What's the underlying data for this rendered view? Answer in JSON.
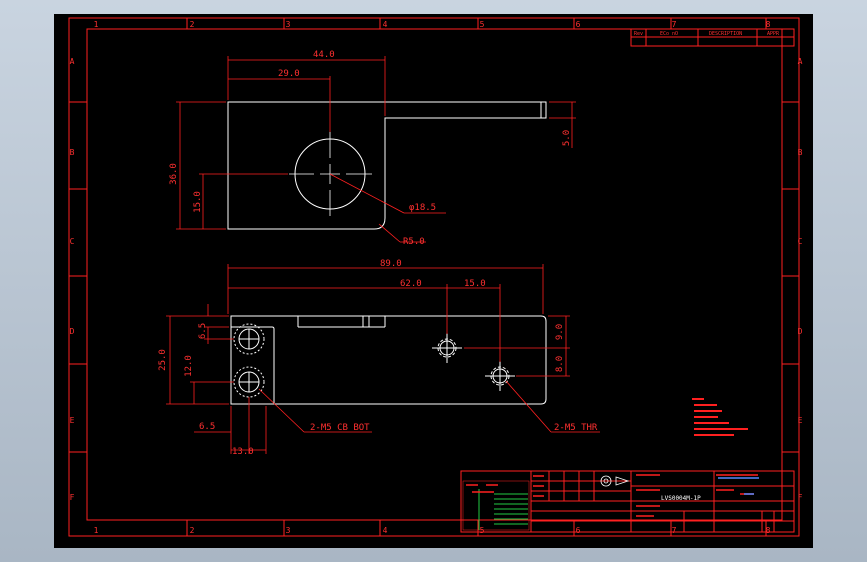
{
  "sheet": {
    "col_labels": [
      "1",
      "2",
      "3",
      "4",
      "5",
      "6",
      "7",
      "8"
    ],
    "row_labels": [
      "A",
      "B",
      "C",
      "D",
      "E",
      "F"
    ]
  },
  "revision_block": {
    "headers": [
      "Rev",
      "ECo nO",
      "DESCRIPTION",
      "APPR"
    ]
  },
  "top_view": {
    "dim_overall_width": "44.0",
    "dim_hole_x": "29.0",
    "dim_height": "36.0",
    "dim_hole_y": "15.0",
    "dim_tab_thick": "5.0",
    "hole_callout": "φ18.5",
    "radius_callout": "R5.0"
  },
  "front_view": {
    "dim_length": "89.0",
    "dim_hole1_x": "62.0",
    "dim_hole_spacing": "15.0",
    "dim_height": "25.0",
    "dim_cb_y": "12.0",
    "dim_top_off": "6.5",
    "dim_left_off": "6.5",
    "dim_cb_pitch": "13.0",
    "dim_h1_y": "9.0",
    "dim_h2_y": "8.0",
    "callout_cb": "2-M5 CB BOT",
    "callout_thr": "2-M5 THR"
  },
  "title_block": {
    "drawing_no": "LVS0004M-1P"
  },
  "colors": {
    "background": "#000000",
    "border": "#ff2020",
    "geometry": "#ffffff"
  }
}
